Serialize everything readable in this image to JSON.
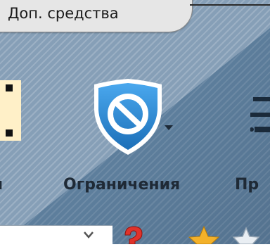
{
  "tab": {
    "label": "Доп. средства"
  },
  "toolbar": {
    "restrictions_label": "Ограничения",
    "next_label_partial": "Пр"
  },
  "icons": {
    "restrictions": "no-entry-shield-icon",
    "dropdown": "triangle-down-icon",
    "next": "speed-lines-icon",
    "help": "question-mark-icon",
    "favorite": "star-icon",
    "favorite_alt": "star-outline-icon"
  },
  "colors": {
    "shield_blue": "#2f8fd8",
    "background": "#6483a2",
    "text": "#1f2a36"
  }
}
